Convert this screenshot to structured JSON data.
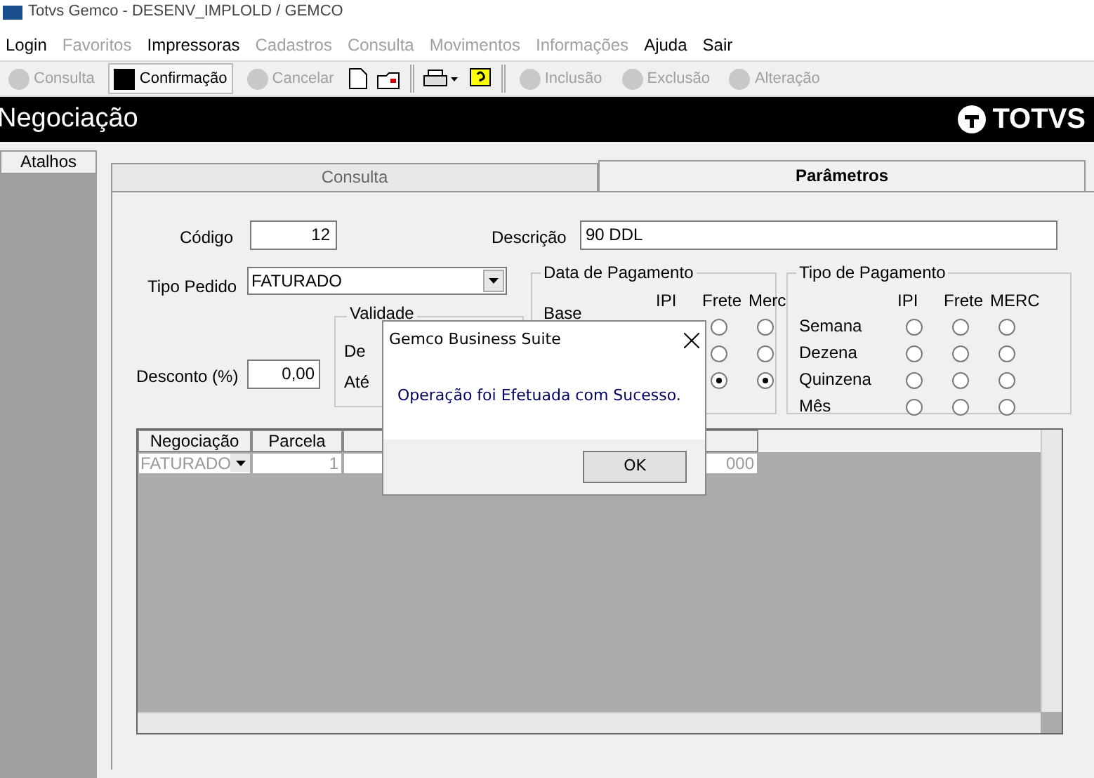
{
  "window": {
    "title": "Totvs Gemco - DESENV_IMPLOLD / GEMCO"
  },
  "menu": [
    {
      "label": "Login",
      "disabled": false
    },
    {
      "label": "Favoritos",
      "disabled": true
    },
    {
      "label": "Impressoras",
      "disabled": false
    },
    {
      "label": "Cadastros",
      "disabled": true
    },
    {
      "label": "Consulta",
      "disabled": true
    },
    {
      "label": "Movimentos",
      "disabled": true
    },
    {
      "label": "Informações",
      "disabled": true
    },
    {
      "label": "Ajuda",
      "disabled": false
    },
    {
      "label": "Sair",
      "disabled": false
    }
  ],
  "toolbar": [
    {
      "kind": "text",
      "label": "Consulta",
      "disabled": true,
      "selected": false
    },
    {
      "kind": "text",
      "label": "Confirmação",
      "disabled": false,
      "selected": true
    },
    {
      "kind": "text",
      "label": "Cancelar",
      "disabled": true,
      "selected": false
    },
    {
      "kind": "new"
    },
    {
      "kind": "open"
    },
    {
      "kind": "sep"
    },
    {
      "kind": "print"
    },
    {
      "kind": "help"
    },
    {
      "kind": "sep"
    },
    {
      "kind": "text",
      "label": "Inclusão",
      "disabled": true,
      "selected": false
    },
    {
      "kind": "text",
      "label": "Exclusão",
      "disabled": true,
      "selected": false
    },
    {
      "kind": "text",
      "label": "Alteração",
      "disabled": true,
      "selected": false
    }
  ],
  "header": {
    "title": "Negociação",
    "logo": "TOTVS"
  },
  "sidebar": {
    "title": "Atalhos"
  },
  "tabs": [
    {
      "label": "Consulta",
      "selected": false
    },
    {
      "label": "Parâmetros",
      "selected": true
    }
  ],
  "form": {
    "codigo": {
      "label": "Código",
      "value": "12"
    },
    "descricao": {
      "label": "Descrição",
      "value": "90 DDL"
    },
    "tipo_pedido": {
      "label": "Tipo Pedido",
      "value": "FATURADO"
    },
    "desconto": {
      "label": "Desconto (%)",
      "value": "0,00"
    },
    "validade": {
      "title": "Validade",
      "labels": [
        "De",
        "Até"
      ]
    }
  },
  "data_pagamento": {
    "title": "Data de Pagamento",
    "columns": [
      "IPI",
      "Frete",
      "Merc"
    ],
    "rows": [
      {
        "label": "Base",
        "options": [
          {
            "checked": false
          },
          {
            "checked": false
          }
        ]
      },
      {
        "options": [
          {
            "checked": false
          },
          {
            "checked": false
          }
        ]
      },
      {
        "options": [
          {
            "checked": true
          },
          {
            "checked": true
          }
        ]
      }
    ]
  },
  "tipo_pagamento": {
    "title": "Tipo de Pagamento",
    "columns": [
      "IPI",
      "Frete",
      "MERC"
    ],
    "rows": [
      {
        "label": "Semana",
        "options": [
          {
            "checked": false
          },
          {
            "checked": false
          },
          {
            "checked": false
          }
        ]
      },
      {
        "label": "Dezena",
        "options": [
          {
            "checked": false
          },
          {
            "checked": false
          },
          {
            "checked": false
          }
        ]
      },
      {
        "label": "Quinzena",
        "options": [
          {
            "checked": false
          },
          {
            "checked": false
          },
          {
            "checked": false
          }
        ]
      },
      {
        "label": "Mês",
        "options": [
          {
            "checked": false
          },
          {
            "checked": false
          },
          {
            "checked": false
          }
        ]
      }
    ]
  },
  "grid": {
    "columns": [
      "Negociação",
      "Parcela"
    ],
    "row": {
      "negociacao": "FATURADO",
      "parcela": "1",
      "column_3": "000"
    }
  },
  "dialog": {
    "title": "Gemco Business Suite",
    "message": "Operação foi Efetuada com Sucesso.",
    "button": "OK"
  }
}
